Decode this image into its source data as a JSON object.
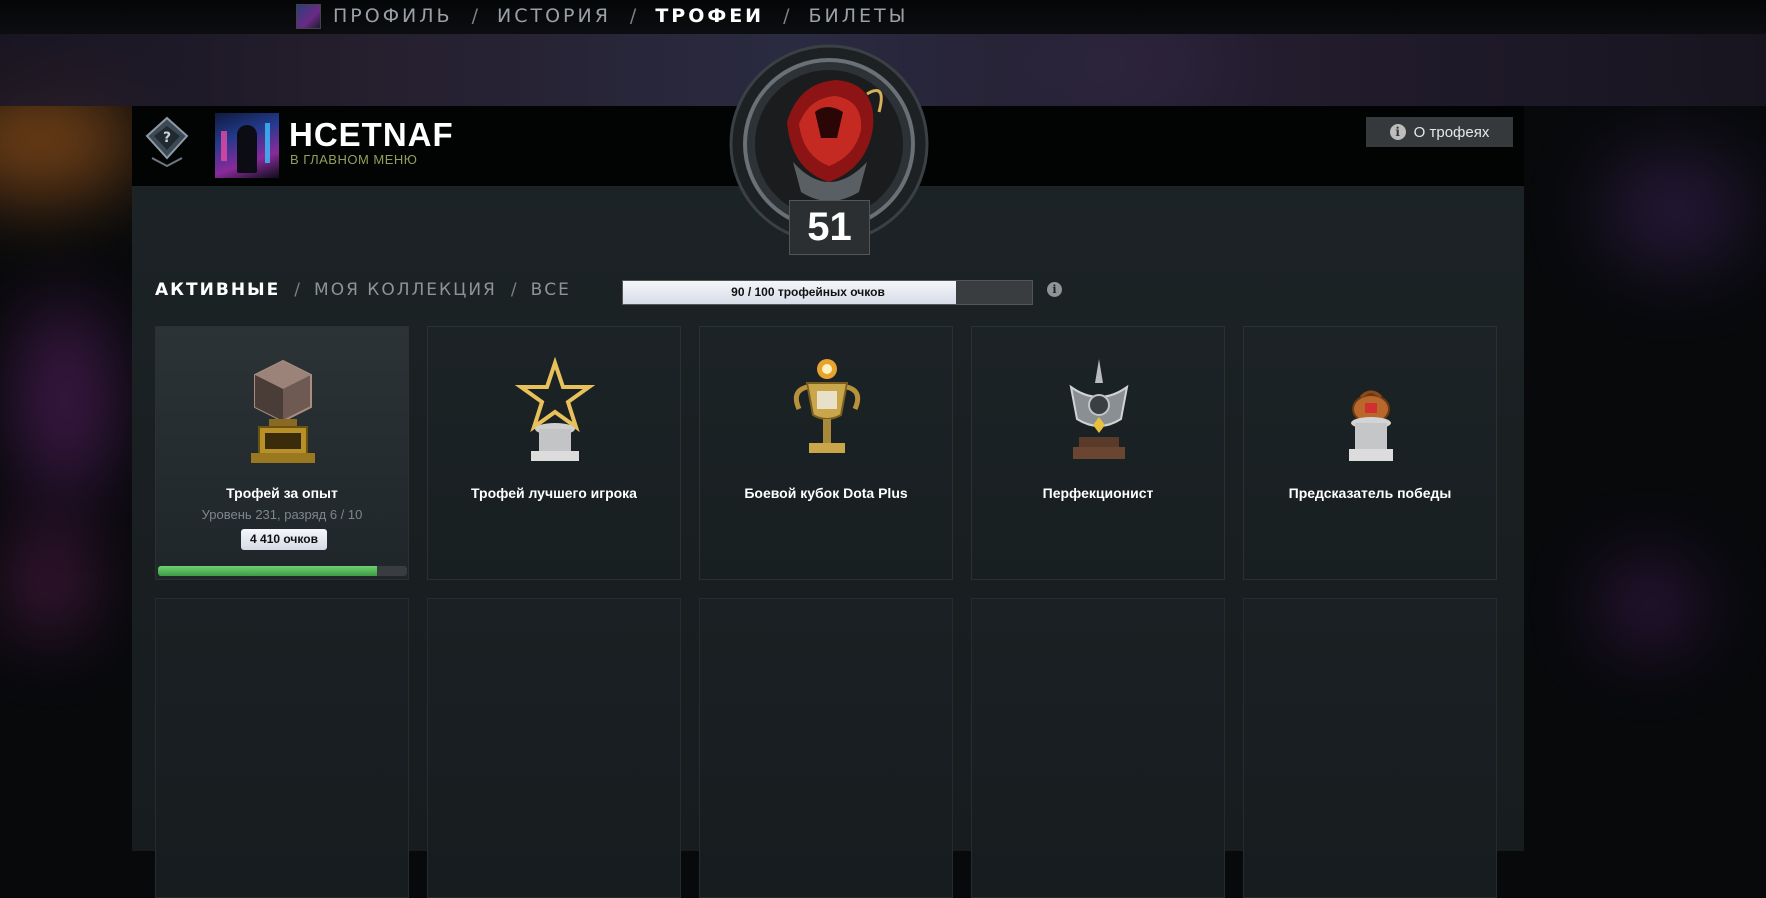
{
  "nav": {
    "items": [
      {
        "label": "ПРОФИЛЬ",
        "active": false
      },
      {
        "label": "ИСТОРИЯ",
        "active": false
      },
      {
        "label": "ТРОФЕИ",
        "active": true
      },
      {
        "label": "БИЛЕТЫ",
        "active": false
      }
    ],
    "separator": "/"
  },
  "player": {
    "name": "HCETNAF",
    "status": "В ГЛАВНОМ МЕНЮ",
    "rank_icon": "question-medal-icon"
  },
  "about_button": {
    "label": "О трофеях",
    "icon": "info-icon"
  },
  "level": {
    "value": "51"
  },
  "tabs": [
    {
      "label": "АКТИВНЫЕ",
      "active": true
    },
    {
      "label": "МОЯ КОЛЛЕКЦИЯ",
      "active": false
    },
    {
      "label": "ВСЕ",
      "active": false
    }
  ],
  "trophy_points": {
    "label": "90 / 100 трофейных очков",
    "current": 90,
    "max": 100
  },
  "trophies": [
    {
      "title": "Трофей за опыт",
      "subtitle": "Уровень 231, разряд 6 / 10",
      "points": "4 410 очков",
      "progress": 0.88,
      "icon": "cube-trophy-icon"
    },
    {
      "title": "Трофей лучшего игрока",
      "icon": "star-trophy-icon"
    },
    {
      "title": "Боевой кубок Dota Plus",
      "icon": "cup-trophy-icon"
    },
    {
      "title": "Перфекционист",
      "icon": "trident-trophy-icon"
    },
    {
      "title": "Предсказатель победы",
      "icon": "moneybag-trophy-icon"
    }
  ],
  "colors": {
    "accent_green": "#8fa05a",
    "progress_green": "#4caf50",
    "panel": "#1b2124"
  }
}
